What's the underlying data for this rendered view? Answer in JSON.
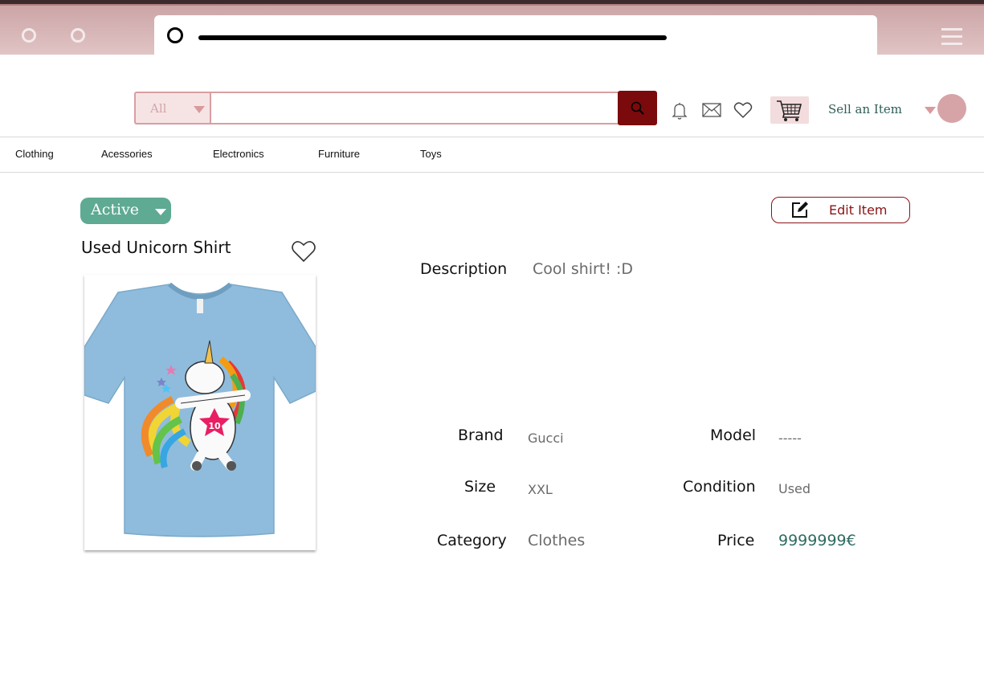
{
  "nav": {
    "categories": [
      "Clothing",
      "Acessories",
      "Electronics",
      "Furniture",
      "Toys"
    ]
  },
  "header": {
    "search_category": "All",
    "search_value": "",
    "sell_label": "Sell an Item"
  },
  "item": {
    "status": "Active",
    "edit_label": "Edit Item",
    "title": "Used Unicorn Shirt",
    "description_label": "Description",
    "description": "Cool shirt! :D",
    "brand_label": "Brand",
    "brand": "Gucci",
    "model_label": "Model",
    "model": "-----",
    "size_label": "Size",
    "size": "XXL",
    "condition_label": "Condition",
    "condition": "Used",
    "category_label": "Category",
    "category": "Clothes",
    "price_label": "Price",
    "price": "9999999€",
    "shirt_badge_number": "10"
  },
  "colors": {
    "brand_dark_red": "#7a0a0c",
    "accent_pink": "#d99ea1",
    "status_green": "#5eaa92",
    "price_green": "#2f6b62"
  }
}
